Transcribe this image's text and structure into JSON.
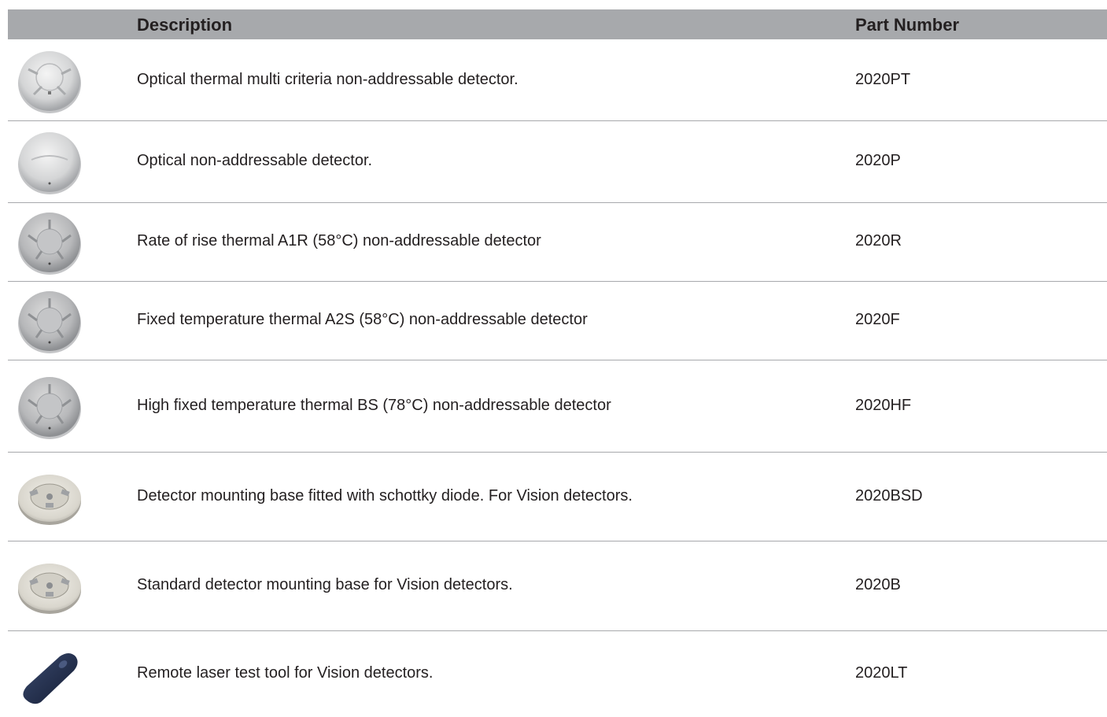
{
  "header": {
    "description": "Description",
    "part_number": "Part Number"
  },
  "rows": [
    {
      "description": "Optical thermal multi criteria non-addressable detector.",
      "part": "2020PT",
      "image": "detector-optical-thermal-image"
    },
    {
      "description": "Optical non-addressable detector.",
      "part": "2020P",
      "image": "detector-optical-image"
    },
    {
      "description": "Rate of rise thermal A1R (58°C) non-addressable detector",
      "part": "2020R",
      "image": "detector-heat-image"
    },
    {
      "description": "Fixed temperature thermal A2S (58°C) non-addressable detector",
      "part": "2020F",
      "image": "detector-heat-image"
    },
    {
      "description": "High fixed temperature thermal BS (78°C) non-addressable detector",
      "part": "2020HF",
      "image": "detector-heat-image"
    },
    {
      "description": "Detector mounting base fitted with schottky diode. For Vision detectors.",
      "part": "2020BSD",
      "image": "mounting-base-image"
    },
    {
      "description": "Standard detector mounting base for Vision detectors.",
      "part": "2020B",
      "image": "mounting-base-image"
    },
    {
      "description": "Remote laser test tool for Vision detectors.",
      "part": "2020LT",
      "image": "laser-test-tool-image"
    }
  ],
  "colors": {
    "header_bg": "#a7a9ac",
    "separator": "#a7a9ac",
    "text": "#231f20",
    "tool": "#1f2a44"
  }
}
